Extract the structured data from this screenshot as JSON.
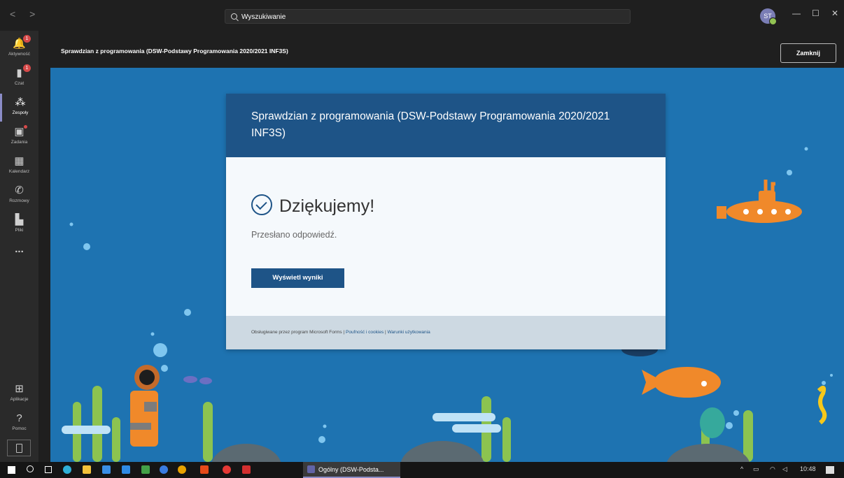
{
  "topbar": {
    "back_forward": "< >",
    "search_placeholder": "Wyszukiwanie",
    "avatar_initials": "ST",
    "minimize": "—",
    "maximize": "☐",
    "close": "✕"
  },
  "rail": {
    "items": [
      {
        "label": "Aktywność",
        "icon": "bell-icon",
        "badge": "1"
      },
      {
        "label": "Czat",
        "icon": "chat-icon",
        "badge": "1"
      },
      {
        "label": "Zespoły",
        "icon": "teams-icon",
        "active": true
      },
      {
        "label": "Zadania",
        "icon": "assignments-icon",
        "dot": true
      },
      {
        "label": "Kalendarz",
        "icon": "calendar-icon"
      },
      {
        "label": "Rozmowy",
        "icon": "phone-icon"
      },
      {
        "label": "Pliki",
        "icon": "files-icon"
      },
      {
        "label": "...",
        "icon": "more-icon"
      }
    ],
    "bottom": [
      {
        "label": "Aplikacje",
        "icon": "apps-icon"
      },
      {
        "label": "Pomoc",
        "icon": "help-icon"
      }
    ]
  },
  "header": {
    "title": "Sprawdzian z programowania (DSW-Podstawy Programowania 2020/2021 INF3S)",
    "close_label": "Zamknij"
  },
  "form": {
    "title": "Sprawdzian z programowania (DSW-Podstawy Programowania 2020/2021 INF3S)",
    "thanks": "Dziękujemy!",
    "submitted": "Przesłano odpowiedź.",
    "results_button": "Wyświetl wyniki",
    "footer_prefix": "Obsługiwane przez program Microsoft Forms |",
    "privacy_link": "Poufność i cookies",
    "separator": "|",
    "terms_link": "Warunki użytkowania"
  },
  "taskbar": {
    "app_label": "Ogólny (DSW-Podsta...",
    "time": "10:48"
  },
  "colors": {
    "accent": "#1e5487",
    "stage_bg": "#1e73b1",
    "teams_purple": "#8b8cc7"
  }
}
